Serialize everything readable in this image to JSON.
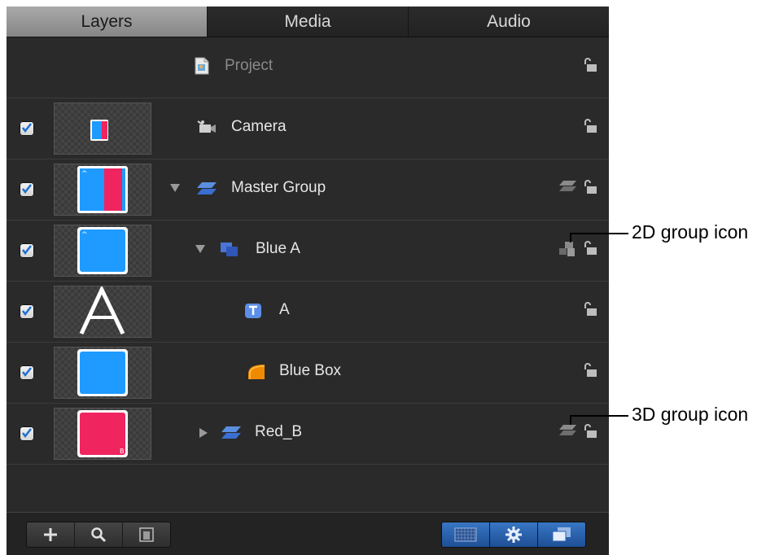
{
  "tabs": [
    {
      "label": "Layers",
      "active": true
    },
    {
      "label": "Media",
      "active": false
    },
    {
      "label": "Audio",
      "active": false
    }
  ],
  "layers": [
    {
      "label": "Project",
      "icon": "project-icon",
      "checked": null,
      "lock": "unlocked"
    },
    {
      "label": "Camera",
      "icon": "camera-icon",
      "checked": true,
      "lock": "unlocked"
    },
    {
      "label": "Master Group",
      "icon": "3d-group-icon",
      "checked": true,
      "disclosure": "expanded",
      "lock": "unlocked",
      "group_mode": "3D"
    },
    {
      "label": "Blue A",
      "icon": "2d-group-icon",
      "checked": true,
      "disclosure": "expanded",
      "lock": "unlocked",
      "group_mode": "2D"
    },
    {
      "label": "A",
      "icon": "text-layer-icon",
      "checked": true,
      "lock": "unlocked"
    },
    {
      "label": "Blue Box",
      "icon": "shape-icon",
      "checked": true,
      "lock": "unlocked"
    },
    {
      "label": "Red_B",
      "icon": "3d-group-icon",
      "checked": true,
      "disclosure": "collapsed",
      "lock": "unlocked",
      "group_mode": "3D"
    }
  ],
  "toolbar": {
    "left_buttons": [
      "add-icon",
      "search-icon",
      "layer-thumbnail-icon"
    ],
    "right_buttons": [
      "show-thumbnails-icon",
      "show-filters-icon",
      "show-masks-icon"
    ]
  },
  "callouts": {
    "group_2d": "2D group icon",
    "group_3d": "3D group icon"
  },
  "colors": {
    "panel_bg": "#2a2a2a",
    "active_tab": "#9a9a9a",
    "card_blue": "#1f9bff",
    "card_red": "#f0245f",
    "toolbar_blue": "#2b63b0"
  }
}
